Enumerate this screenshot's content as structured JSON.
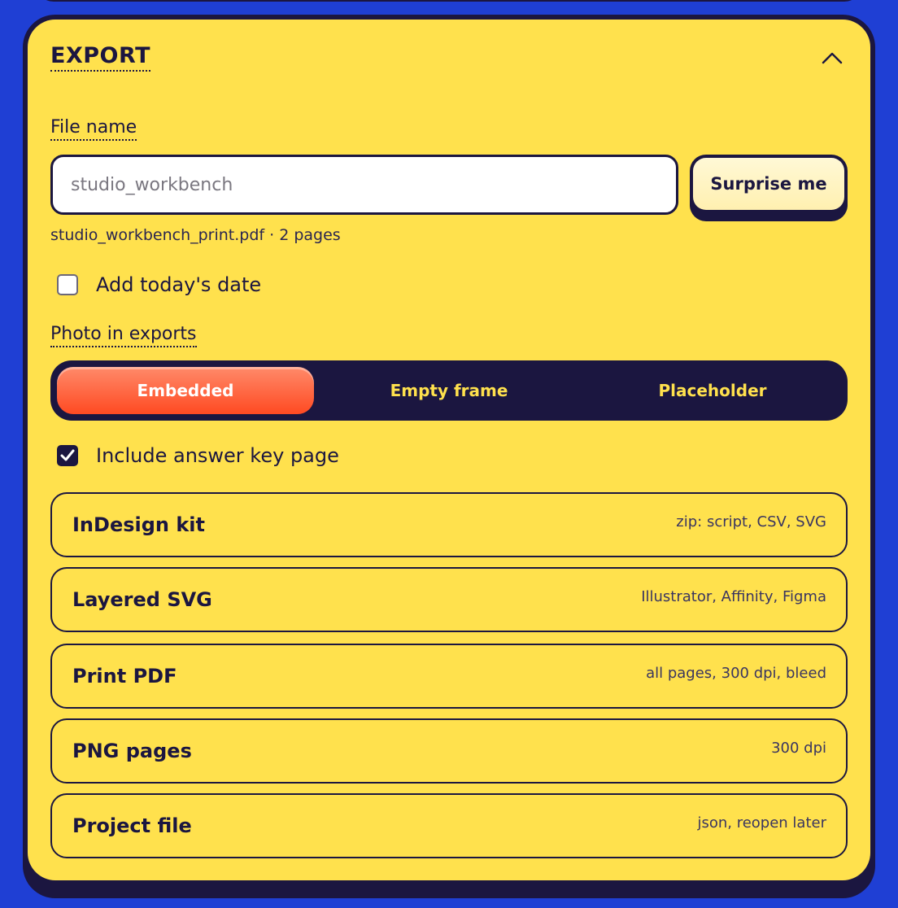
{
  "export": {
    "title": "EXPORT",
    "file_name": {
      "label": "File name",
      "placeholder": "studio_workbench",
      "value": "",
      "surprise_label": "Surprise me",
      "hint": "studio_workbench_print.pdf · 2 pages"
    },
    "add_date": {
      "label": "Add today's date",
      "checked": false
    },
    "photo": {
      "label": "Photo in exports",
      "options": [
        "Embedded",
        "Empty frame",
        "Placeholder"
      ],
      "selected": "Embedded"
    },
    "answer_key": {
      "label": "Include answer key page",
      "checked": true
    },
    "formats": [
      {
        "name": "InDesign kit",
        "detail": "zip: script, CSV, SVG"
      },
      {
        "name": "Layered SVG",
        "detail": "Illustrator, Affinity, Figma"
      },
      {
        "name": "Print PDF",
        "detail": "all pages, 300 dpi, bleed"
      },
      {
        "name": "PNG pages",
        "detail": "300 dpi"
      },
      {
        "name": "Project file",
        "detail": "json, reopen later"
      }
    ],
    "icons": {
      "collapse": "chevron-up-icon",
      "check": "checkmark-icon"
    },
    "colors": {
      "background": "#1f3fd4",
      "panel": "#ffe14d",
      "ink": "#1b1640",
      "accent": "#ff4a22"
    }
  }
}
